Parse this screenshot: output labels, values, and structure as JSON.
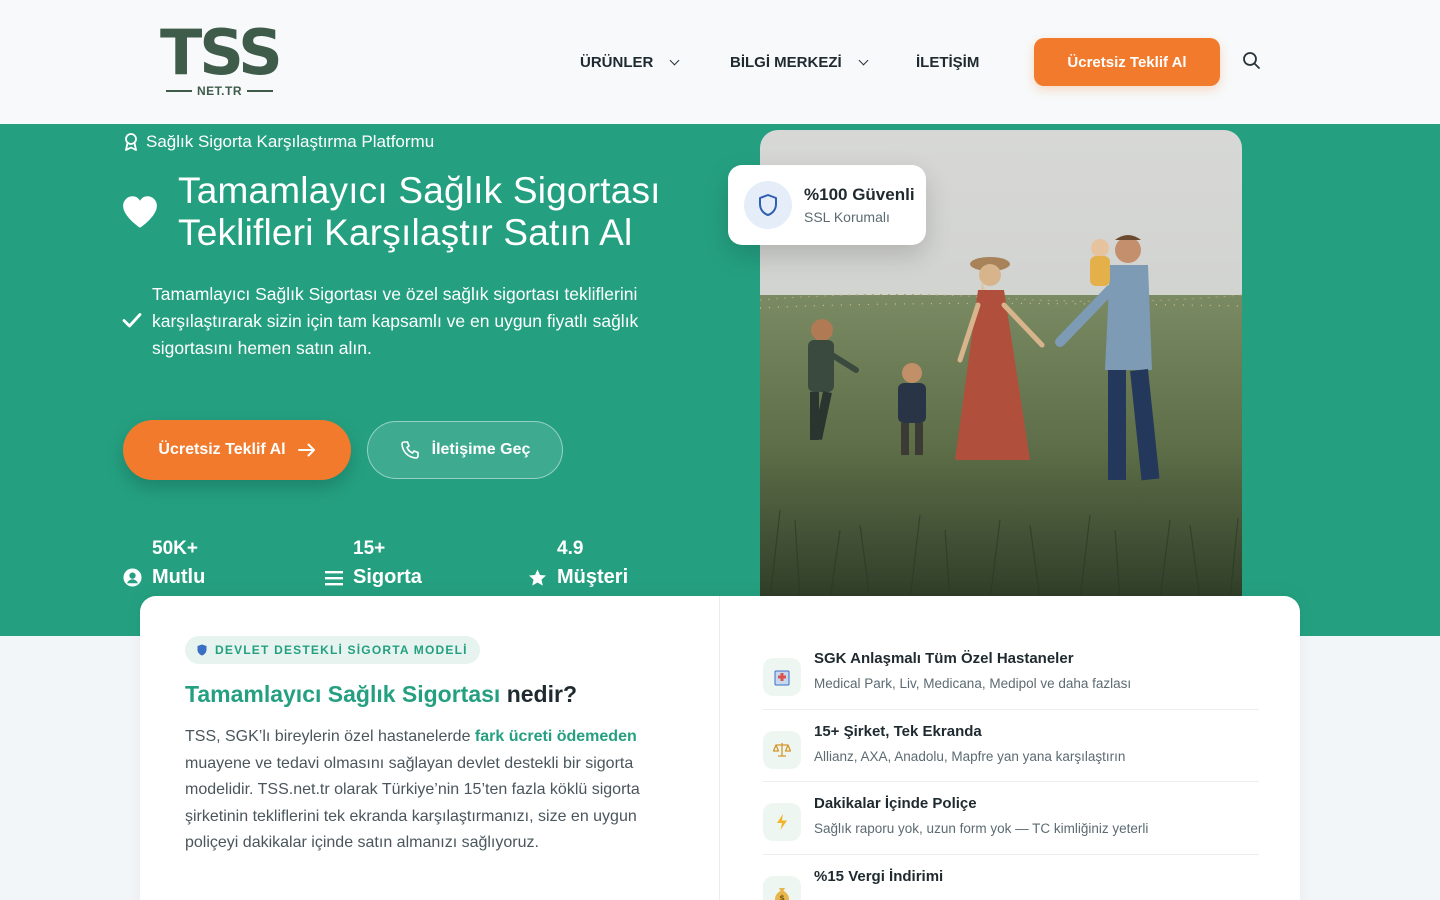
{
  "header": {
    "logo_main": "TSS",
    "logo_sub": "NET.TR",
    "nav": [
      {
        "label": "ÜRÜNLER",
        "dropdown": true
      },
      {
        "label": "BİLGİ MERKEZİ",
        "dropdown": true
      },
      {
        "label": "İLETİŞİM",
        "dropdown": false
      }
    ],
    "cta_label": "Ücretsiz Teklif Al",
    "search_icon": "search-icon"
  },
  "hero": {
    "badge": "Sağlık Sigorta Karşılaştırma Platformu",
    "title_line1": "Tamamlayıcı Sağlık Sigortası",
    "title_line2": "Teklifleri Karşılaştır Satın Al",
    "description": "Tamamlayıcı Sağlık Sigortası ve özel sağlık sigortası tekliflerini karşılaştırarak sizin için tam kapsamlı ve en uygun fiyatlı sağlık sigortasını hemen satın alın.",
    "primary_button": "Ücretsiz Teklif Al",
    "secondary_button": "İletişime Geç",
    "stats": [
      {
        "number": "50K+",
        "label": "Mutlu",
        "icon": "user-circle-icon"
      },
      {
        "number": "15+",
        "label": "Sigorta",
        "icon": "list-icon"
      },
      {
        "number": "4.9",
        "label": "Müşteri",
        "icon": "star-icon"
      }
    ],
    "trust_card": {
      "title": "%100 Güvenli",
      "subtitle": "SSL Korumalı",
      "icon": "shield-icon"
    }
  },
  "about": {
    "pill": "DEVLET DESTEKLİ SİGORTA MODELİ",
    "heading_accent": "Tamamlayıcı Sağlık Sigortası",
    "heading_rest": " nedir?",
    "p_part1": "TSS, SGK’lı bireylerin özel hastanelerde ",
    "p_highlight": "fark ücreti ödemeden",
    "p_part2": " muayene ve tedavi olmasını sağlayan devlet destekli bir sigorta modelidir. TSS.net.tr olarak Türkiye’nin 15’ten fazla köklü sigorta şirketinin tekliflerini tek ekranda karşılaştırmanızı, size en uygun poliçeyi dakikalar içinde satın almanızı sağlıyoruz."
  },
  "features": [
    {
      "icon": "hospital-icon",
      "glyph": "🏥",
      "title": "SGK Anlaşmalı Tüm Özel Hastaneler",
      "subtitle": "Medical Park, Liv, Medicana, Medipol ve daha fazlası"
    },
    {
      "icon": "scale-icon",
      "glyph": "⚖",
      "title": "15+ Şirket, Tek Ekranda",
      "subtitle": "Allianz, AXA, Anadolu, Mapfre yan yana karşılaştırın"
    },
    {
      "icon": "lightning-icon",
      "glyph": "⚡",
      "title": "Dakikalar İçinde Poliçe",
      "subtitle": "Sağlık raporu yok, uzun form yok — TC kimliğiniz yeterli"
    },
    {
      "icon": "money-bag-icon",
      "glyph": "$",
      "title": "%15 Vergi İndirimi",
      "subtitle": ""
    }
  ],
  "colors": {
    "brand_green": "#24a081",
    "accent_orange": "#f27a2c",
    "logo_green": "#3f5b4a"
  }
}
